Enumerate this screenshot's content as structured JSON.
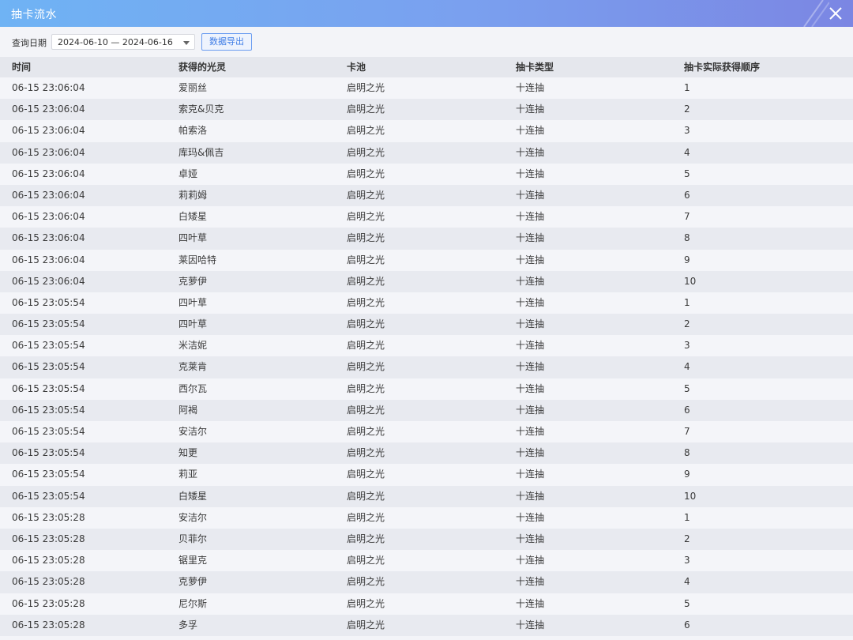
{
  "window": {
    "title": "抽卡流水"
  },
  "toolbar": {
    "query_label": "查询日期",
    "date_range": "2024-06-10 — 2024-06-16",
    "export_label": "数据导出"
  },
  "table": {
    "columns": [
      "时间",
      "获得的光灵",
      "卡池",
      "抽卡类型",
      "抽卡实际获得顺序"
    ],
    "rows": [
      [
        "06-15 23:06:04",
        "爱丽丝",
        "启明之光",
        "十连抽",
        "1"
      ],
      [
        "06-15 23:06:04",
        "索克&贝克",
        "启明之光",
        "十连抽",
        "2"
      ],
      [
        "06-15 23:06:04",
        "帕索洛",
        "启明之光",
        "十连抽",
        "3"
      ],
      [
        "06-15 23:06:04",
        "库玛&佩吉",
        "启明之光",
        "十连抽",
        "4"
      ],
      [
        "06-15 23:06:04",
        "卓娅",
        "启明之光",
        "十连抽",
        "5"
      ],
      [
        "06-15 23:06:04",
        "莉莉姆",
        "启明之光",
        "十连抽",
        "6"
      ],
      [
        "06-15 23:06:04",
        "白矮星",
        "启明之光",
        "十连抽",
        "7"
      ],
      [
        "06-15 23:06:04",
        "四叶草",
        "启明之光",
        "十连抽",
        "8"
      ],
      [
        "06-15 23:06:04",
        "莱因哈特",
        "启明之光",
        "十连抽",
        "9"
      ],
      [
        "06-15 23:06:04",
        "克萝伊",
        "启明之光",
        "十连抽",
        "10"
      ],
      [
        "06-15 23:05:54",
        "四叶草",
        "启明之光",
        "十连抽",
        "1"
      ],
      [
        "06-15 23:05:54",
        "四叶草",
        "启明之光",
        "十连抽",
        "2"
      ],
      [
        "06-15 23:05:54",
        "米洁妮",
        "启明之光",
        "十连抽",
        "3"
      ],
      [
        "06-15 23:05:54",
        "克莱肯",
        "启明之光",
        "十连抽",
        "4"
      ],
      [
        "06-15 23:05:54",
        "西尔瓦",
        "启明之光",
        "十连抽",
        "5"
      ],
      [
        "06-15 23:05:54",
        "阿褐",
        "启明之光",
        "十连抽",
        "6"
      ],
      [
        "06-15 23:05:54",
        "安洁尔",
        "启明之光",
        "十连抽",
        "7"
      ],
      [
        "06-15 23:05:54",
        "知更",
        "启明之光",
        "十连抽",
        "8"
      ],
      [
        "06-15 23:05:54",
        "莉亚",
        "启明之光",
        "十连抽",
        "9"
      ],
      [
        "06-15 23:05:54",
        "白矮星",
        "启明之光",
        "十连抽",
        "10"
      ],
      [
        "06-15 23:05:28",
        "安洁尔",
        "启明之光",
        "十连抽",
        "1"
      ],
      [
        "06-15 23:05:28",
        "贝菲尔",
        "启明之光",
        "十连抽",
        "2"
      ],
      [
        "06-15 23:05:28",
        "锯里克",
        "启明之光",
        "十连抽",
        "3"
      ],
      [
        "06-15 23:05:28",
        "克萝伊",
        "启明之光",
        "十连抽",
        "4"
      ],
      [
        "06-15 23:05:28",
        "尼尔斯",
        "启明之光",
        "十连抽",
        "5"
      ],
      [
        "06-15 23:05:28",
        "多孚",
        "启明之光",
        "十连抽",
        "6"
      ]
    ]
  },
  "icons": {
    "close": "close-icon",
    "dropdown": "chevron-down-icon"
  },
  "colors": {
    "titlebar_start": "#6fb3f4",
    "titlebar_end": "#7b86e3",
    "accent": "#3f7de6"
  }
}
